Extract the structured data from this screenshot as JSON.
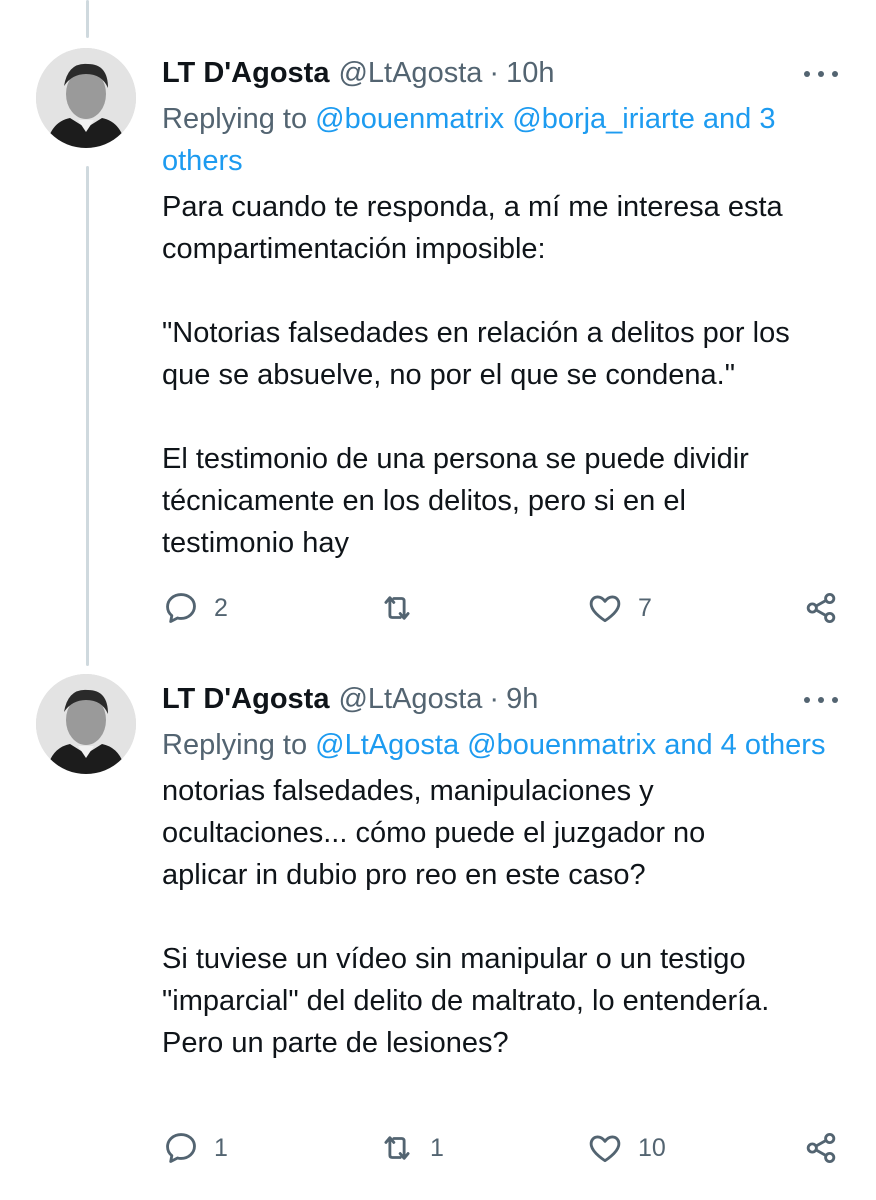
{
  "tweets": [
    {
      "author_name": "LT D'Agosta",
      "author_handle": "@LtAgosta",
      "separator": "·",
      "time": "10h",
      "replying_prefix": "Replying to ",
      "replying_mentions": [
        "@bouenmatrix",
        "@borja_iriarte"
      ],
      "replying_suffix": "and 3 others",
      "text": "Para cuando te responda, a mí me interesa esta\ncompartimentación imposible:\n\n\"Notorias falsedades en relación a delitos por los\nque se absuelve, no por el que se condena.\"\n\nEl testimonio de una persona se puede dividir\ntécnicamente en los delitos, pero si en el\ntestimonio hay",
      "replies": "2",
      "retweets": "",
      "likes": "7"
    },
    {
      "author_name": "LT D'Agosta",
      "author_handle": "@LtAgosta",
      "separator": "·",
      "time": "9h",
      "replying_prefix": "Replying to ",
      "replying_mentions": [
        "@LtAgosta",
        "@bouenmatrix"
      ],
      "replying_suffix": "and 4 others",
      "text": "notorias falsedades, manipulaciones y\nocultaciones... cómo puede el juzgador no\naplicar in dubio pro reo en este caso?\n\nSi tuviese un vídeo sin manipular o un testigo\n\"imparcial\" del delito de maltrato, lo entendería.\nPero un parte de lesiones?",
      "replies": "1",
      "retweets": "1",
      "likes": "10"
    }
  ],
  "icons": {
    "reply": "reply-icon",
    "retweet": "retweet-icon",
    "like": "heart-icon",
    "share": "share-icon",
    "more": "more-icon"
  },
  "colors": {
    "text": "#0f1419",
    "muted": "#536471",
    "link": "#1d9bf0",
    "thread_line": "#cfd9de"
  }
}
